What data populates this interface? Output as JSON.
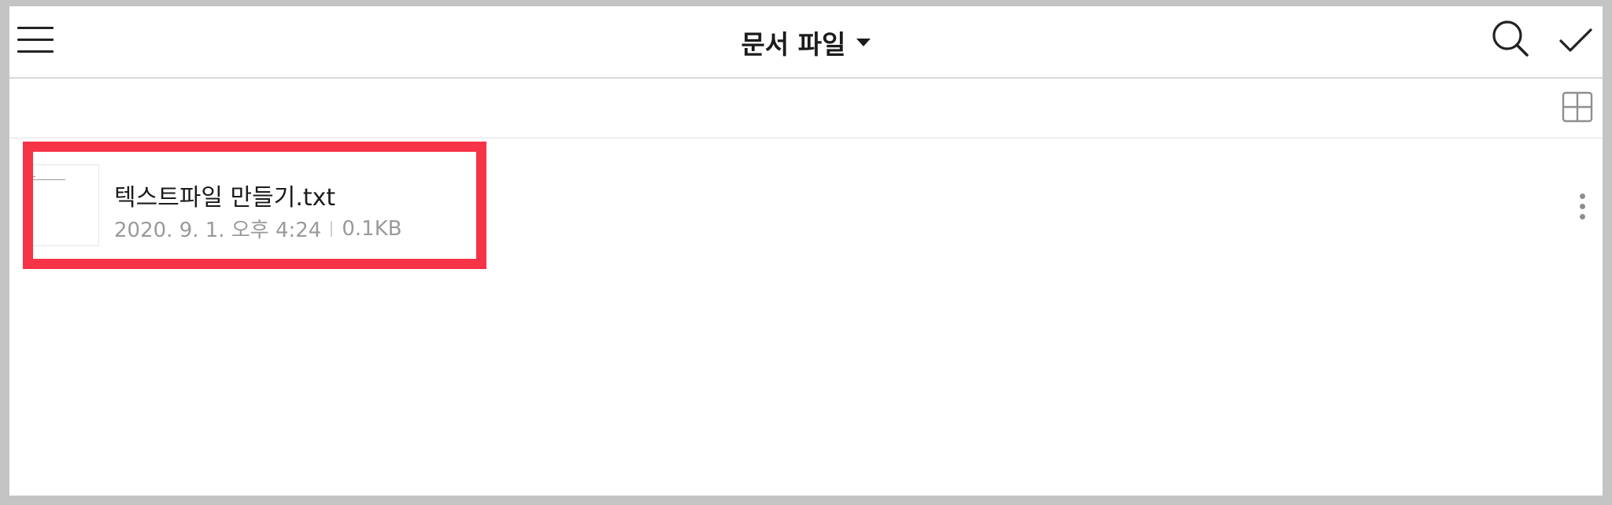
{
  "header": {
    "title": "문서 파일",
    "menu_icon": "hamburger-menu-icon",
    "search_icon": "search-icon",
    "check_icon": "checkmark-icon"
  },
  "toolbar": {
    "view_icon": "grid-view-icon"
  },
  "files": [
    {
      "name": "텍스트파일 만들기.txt",
      "date": "2020. 9. 1. 오후 4:24",
      "size": "0.1KB",
      "more_icon": "more-vertical-icon"
    }
  ],
  "colors": {
    "highlight": "#f73347",
    "background": "#ffffff",
    "frame": "#c4c4c4"
  }
}
